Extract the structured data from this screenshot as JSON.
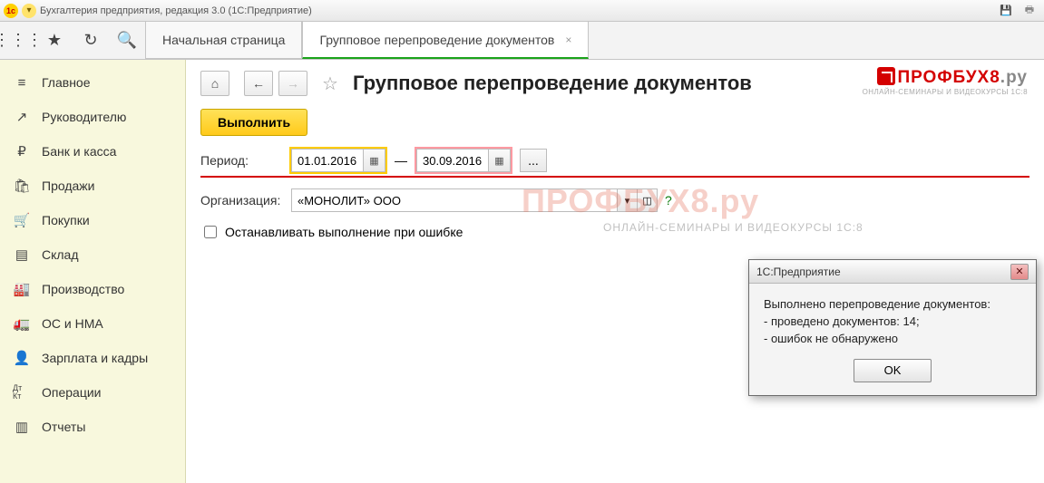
{
  "window_title": "Бухгалтерия предприятия, редакция 3.0  (1С:Предприятие)",
  "tabs": {
    "home": "Начальная страница",
    "active": "Групповое перепроведение документов"
  },
  "sidebar": {
    "items": [
      {
        "icon": "≡",
        "label": "Главное"
      },
      {
        "icon": "↗",
        "label": "Руководителю"
      },
      {
        "icon": "₽",
        "label": "Банк и касса"
      },
      {
        "icon": "🛍",
        "label": "Продажи"
      },
      {
        "icon": "🛒",
        "label": "Покупки"
      },
      {
        "icon": "▤",
        "label": "Склад"
      },
      {
        "icon": "🏭",
        "label": "Производство"
      },
      {
        "icon": "🚛",
        "label": "ОС и НМА"
      },
      {
        "icon": "👤",
        "label": "Зарплата и кадры"
      },
      {
        "icon": "Дт Кт",
        "label": "Операции"
      },
      {
        "icon": "▥",
        "label": "Отчеты"
      }
    ]
  },
  "page": {
    "title": "Групповое перепроведение документов",
    "execute_btn": "Выполнить",
    "period_label": "Период:",
    "date_from": "01.01.2016",
    "date_to": "30.09.2016",
    "dash": "—",
    "dots": "...",
    "org_label": "Организация:",
    "org_value": "«МОНОЛИТ» ООО",
    "stop_on_error": "Останавливать выполнение при ошибке",
    "help": "?"
  },
  "logo": {
    "main_red": "ПРОФБУХ8",
    "main_gray": ".ру",
    "sub": "ОНЛАЙН-СЕМИНАРЫ И ВИДЕОКУРСЫ 1С:8"
  },
  "watermark": {
    "main": "ПРОФБУХ8.ру",
    "sub": "ОНЛАЙН-СЕМИНАРЫ И ВИДЕОКУРСЫ 1С:8"
  },
  "dialog": {
    "title": "1С:Предприятие",
    "line1": "Выполнено перепроведение документов:",
    "line2": "- проведено документов: 14;",
    "line3": "- ошибок не обнаружено",
    "ok": "OK"
  }
}
